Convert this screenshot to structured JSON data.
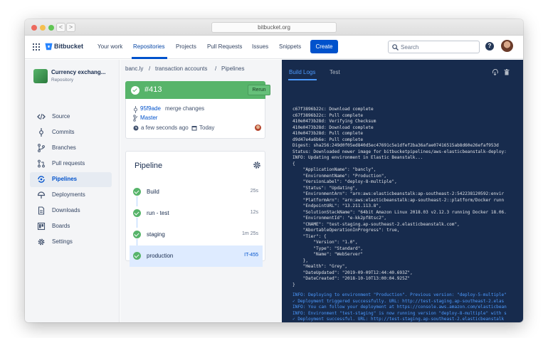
{
  "browser": {
    "url": "bitbucket.org",
    "back_label": "<",
    "forward_label": ">",
    "traffic_colors": [
      "#ed6a5e",
      "#f5bf4f",
      "#61c554"
    ]
  },
  "nav": {
    "logo_text": "Bitbucket",
    "items": [
      "Your work",
      "Repositories",
      "Projects",
      "Pull Requests",
      "Issues",
      "Snippets"
    ],
    "active": "Repositories",
    "create_label": "Create",
    "search_placeholder": "Search",
    "help_label": "?"
  },
  "sidebar": {
    "repo_name": "Currency exchang...",
    "repo_type": "Repository",
    "items": [
      {
        "label": "Source",
        "icon": "code-icon"
      },
      {
        "label": "Commits",
        "icon": "commit-icon"
      },
      {
        "label": "Branches",
        "icon": "branch-icon"
      },
      {
        "label": "Pull requests",
        "icon": "pull-request-icon"
      },
      {
        "label": "Pipelines",
        "icon": "pipelines-icon"
      },
      {
        "label": "Deployments",
        "icon": "deployments-icon"
      },
      {
        "label": "Downloads",
        "icon": "downloads-icon"
      },
      {
        "label": "Boards",
        "icon": "boards-icon"
      },
      {
        "label": "Settings",
        "icon": "settings-icon"
      }
    ],
    "active": "Pipelines"
  },
  "breadcrumb": {
    "items": [
      "banc.ly",
      "transaction accounts",
      "Pipelines"
    ],
    "separator": "/"
  },
  "build": {
    "number": "#413",
    "rerun_label": "Rerun",
    "status_color": "#57b46a",
    "commit_hash": "95f9ade",
    "commit_message": "merge changes",
    "branch": "Master",
    "time_ago": "a few seconds ago",
    "date": "Today"
  },
  "pipeline": {
    "title": "Pipeline",
    "steps": [
      {
        "name": "Build",
        "time": "25s"
      },
      {
        "name": "run - test",
        "time": "12s"
      },
      {
        "name": "staging",
        "time": "1m 25s"
      },
      {
        "name": "production",
        "time": "IT-455"
      }
    ]
  },
  "logs": {
    "tabs": [
      "Build Logs",
      "Test"
    ],
    "active_tab": "Build Logs",
    "lines": [
      "c67f3896b22c: Download complete",
      "c67f3896b22c: Pull complete",
      "410e0473b28d: Verifying Checksum",
      "410e0473b28d: Download complete",
      "410e0473b28d: Pull complete",
      "d9d47e4a6b6e: Pull complete",
      "Digest: sha256:249d0f05ed840d5ec47691c5e1dfef2ba36afae07416515ab8d60e26efaf953d",
      "Status: Downloaded newer image for bitbucketpipelines/aws-elasticbeanstalk-deploy:",
      "INFO: Updating environment in Elastic Beanstalk...",
      "{",
      "    \"ApplicationName\": \"bancly\",",
      "    \"EnvironmentName\": \"Production\",",
      "    \"VersionLabel\": \"deploy-8-multiple\",",
      "    \"Status\": \"Updating\",",
      "    \"EnvironmentArn\": \"arn:aws:elasticbeanstalk:ap-southeast-2:542238120592:envir",
      "    \"PlatformArn\": \"arn:aws:elasticbeanstalk:ap-southeast-2::platform/Docker runn",
      "    \"EndpointURL\": \"13.211.113.8\",",
      "    \"SolutionStackName\": \"64bit Amazon Linux 2018.03 v2.12.3 running Docker 18.06.",
      "    \"EnvironmentId\": \"e-kk2pf8tsc2\",",
      "    \"CNAME\": \"test-staging.ap-southeast-2.elasticbeanstalk.com\",",
      "    \"AbortableOperationInProgress\": true,",
      "    \"Tier\": {",
      "        \"Version\": \"1.0\",",
      "        \"Type\": \"Standard\",",
      "        \"Name\": \"WebServer\"",
      "    },",
      "    \"Health\": \"Grey\",",
      "    \"DateUpdated\": \"2019-09-09T12:44:40.693Z\",",
      "    \"DateCreated\": \"2018-10-10T13:00:04.925Z\"",
      "}"
    ],
    "info_lines": [
      "INFO: Deploying to environment \"Production\". Previous version: \"deploy-5-multiple\"",
      "✓ Deployment triggered successfully. URL: http://test-staging.ap-southeast-2.elas",
      "INFO: You can follow your deployment at https://console.aws.amazon.com/elasticbean",
      "INFO: Environment \"test-staging\" is now running version \"deploy-8-multiple\" with s",
      "✓ Deployment successful. URL: http://test-staging.ap-southeast-2.elasticbeanstalk"
    ]
  }
}
